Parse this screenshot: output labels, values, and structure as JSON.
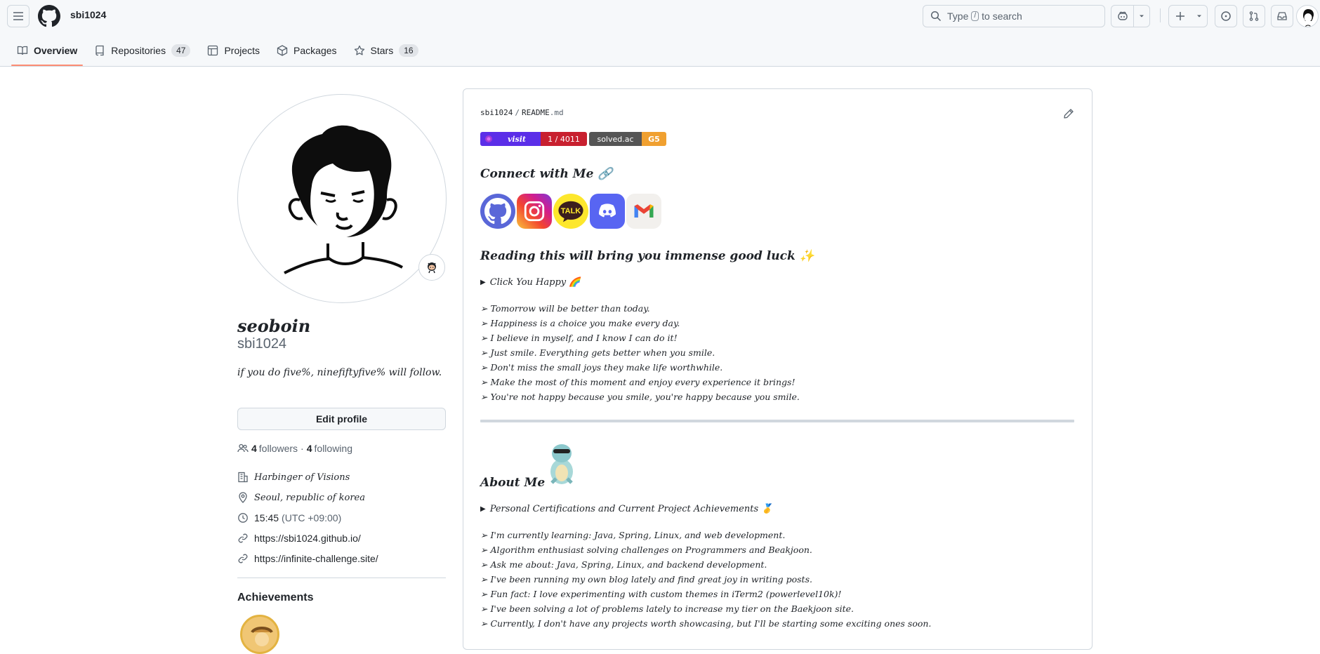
{
  "header": {
    "username": "sbi1024",
    "search": {
      "prefix": "Type",
      "key": "/",
      "suffix": "to search"
    }
  },
  "tabs": [
    {
      "label": "Overview",
      "count": "",
      "icon": "book-icon"
    },
    {
      "label": "Repositories",
      "count": "47",
      "icon": "repo-icon"
    },
    {
      "label": "Projects",
      "count": "",
      "icon": "table-icon"
    },
    {
      "label": "Packages",
      "count": "",
      "icon": "package-icon"
    },
    {
      "label": "Stars",
      "count": "16",
      "icon": "star-icon"
    }
  ],
  "profile": {
    "fullname": "seoboin",
    "login": "sbi1024",
    "bio": "if you do five%, ninefiftyfive% will follow.",
    "edit_label": "Edit profile",
    "followers_count": "4",
    "followers_label": "followers",
    "following_count": "4",
    "following_label": "following",
    "separator": "·",
    "company": "Harbinger of Visions",
    "location": "Seoul, republic of korea",
    "time": "15:45",
    "timezone": "(UTC +09:00)",
    "links": [
      "https://sbi1024.github.io/",
      "https://infinite-challenge.site/"
    ],
    "achievements_title": "Achievements"
  },
  "readme": {
    "owner": "sbi1024",
    "sep": "/",
    "file_name": "README",
    "file_ext": ".md",
    "badges": {
      "visit_label": "visit",
      "visit_value": "1 / 4011",
      "solved_label": "solved.ac",
      "solved_value": "G5"
    },
    "connect_title": "Connect with Me 🔗",
    "social": [
      "github-icon",
      "instagram-icon",
      "kakaotalk-icon",
      "discord-icon",
      "gmail-icon"
    ],
    "kakao_text": "TALK",
    "luck_title": "Reading this will bring you immense good luck ✨",
    "details_1": "Click You Happy 🌈",
    "happy_lines": [
      "➢ Tomorrow will be better than today.",
      "➢ Happiness is a choice you make every day.",
      "➢ I believe in myself, and I know I can do it!",
      "➢ Just smile. Everything gets better when you smile.",
      "➢ Don't miss the small joys they make life worthwhile.",
      "➢ Make the most of this moment and enjoy every experience it brings!",
      "➢ You're not happy because you smile, you're happy because you smile."
    ],
    "about_title": "About Me",
    "details_2": "Personal Certifications and Current Project Achievements 🥇",
    "about_lines": [
      "➢ I'm currently learning: Java, Spring, Linux, and web development.",
      "➢ Algorithm enthusiast solving challenges on Programmers and Beakjoon.",
      "➢ Ask me about: Java, Spring, Linux, and backend development.",
      "➢ I've been running my own blog lately and find great joy in writing posts.",
      "➢ Fun fact: I love experimenting with custom themes in iTerm2 (powerlevel10k)!",
      "➢ I've been solving a lot of problems lately to increase my tier on the Baekjoon site.",
      "➢ Currently, I don't have any projects worth showcasing, but I'll be starting some exciting ones soon."
    ]
  },
  "colors": {
    "accent_underline": "#fd8c73",
    "visit_left": "#5b2ee8",
    "visit_right": "#c8202f",
    "solved_left": "#555555",
    "solved_right": "#f0a030"
  }
}
